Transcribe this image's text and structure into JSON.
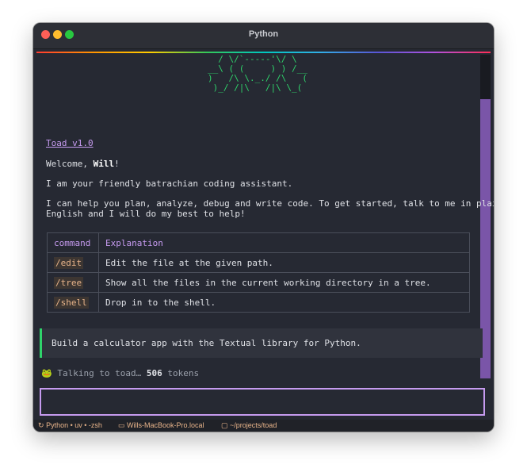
{
  "window": {
    "title": "Python"
  },
  "header": {
    "ascii_art": "  / \\/`-----'\\/ \\\n__\\ ( (     ) ) /__\n)   /\\ \\._./ /\\   (\n )_/ /|\\   /|\\ \\_("
  },
  "content": {
    "version_link": "Toad v1.0",
    "welcome_prefix": "Welcome, ",
    "welcome_name": "Will",
    "welcome_suffix": "!",
    "intro": "I am your friendly batrachian coding assistant.",
    "help_line1": "I can help you plan, analyze, debug and write code. To get started, talk to me in plain",
    "help_line2": "English and I will do my best to help!",
    "table": {
      "headers": [
        "command",
        "Explanation"
      ],
      "rows": [
        {
          "command": "/edit",
          "explanation": "Edit the file at the given path."
        },
        {
          "command": "/tree",
          "explanation": "Show all the files in the current working directory in a tree."
        },
        {
          "command": "/shell",
          "explanation": "Drop in to the shell."
        }
      ]
    },
    "prompt_text": "Build a calculator app with the Textual library for Python.",
    "status_icon": "frog-icon",
    "status_prefix": "Talking to toad… ",
    "status_count": "506",
    "status_suffix": " tokens"
  },
  "input": {
    "value": ""
  },
  "statusbar": {
    "session": "Python • uv • -zsh",
    "host": "Wills-MacBook-Pro.local",
    "path": "~/projects/toad"
  }
}
